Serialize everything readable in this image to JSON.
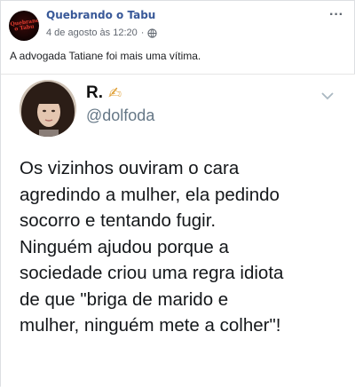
{
  "post": {
    "page_name": "Quebrando o Tabu",
    "avatar_text": "Quebrando o Tabu",
    "timestamp": "4 de agosto às 12:20",
    "separator": "·",
    "more_label": "···",
    "caption": "A advogada Tatiane foi mais uma vítima."
  },
  "tweet": {
    "name": "R.",
    "emoji": "✍",
    "handle": "@dolfoda",
    "lines": [
      "Os vizinhos ouviram o cara",
      "agredindo a mulher, ela pedindo",
      "socorro e tentando fugir.",
      "Ninguém ajudou porque a",
      "sociedade criou uma regra idiota",
      "de que \"briga de marido e",
      "mulher, ninguém mete a colher\"!"
    ]
  },
  "icons": {
    "globe": "globe-icon",
    "more": "more-icon",
    "chevron": "chevron-down-icon"
  },
  "colors": {
    "page_name": "#385898",
    "meta": "#616770",
    "handle": "#657786",
    "tweet_text": "#14171a"
  }
}
